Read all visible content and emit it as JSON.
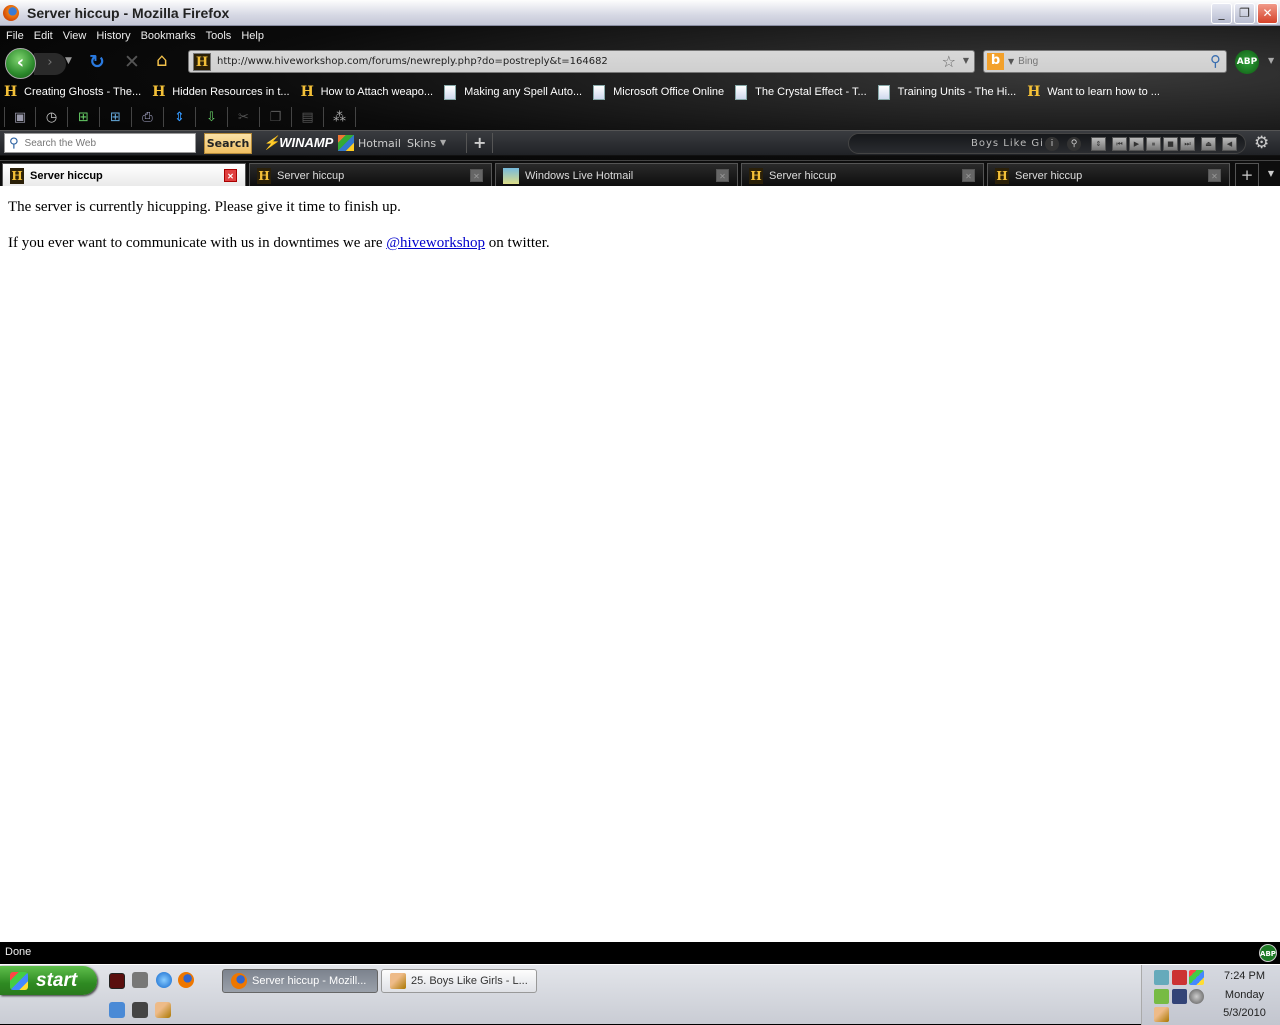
{
  "window": {
    "title": "Server hiccup - Mozilla Firefox",
    "controls": {
      "minimize": "_",
      "restore": "❐",
      "close": "✕"
    }
  },
  "menu": [
    "File",
    "Edit",
    "View",
    "History",
    "Bookmarks",
    "Tools",
    "Help"
  ],
  "nav": {
    "back_icon": "‹",
    "forward_icon": "›",
    "url": "http://www.hiveworkshop.com/forums/newreply.php?do=postreply&t=164682",
    "search_placeholder": "Bing",
    "addon_badge": "ABP"
  },
  "bookmarks": [
    {
      "label": "Creating Ghosts - The...",
      "icon": "hive-icon"
    },
    {
      "label": "Hidden Resources in t...",
      "icon": "hive-icon"
    },
    {
      "label": "How to Attach weapo...",
      "icon": "hive-icon"
    },
    {
      "label": "Making any Spell Auto...",
      "icon": "page-icon"
    },
    {
      "label": "Microsoft Office Online",
      "icon": "page-icon"
    },
    {
      "label": "The Crystal Effect - T...",
      "icon": "page-icon"
    },
    {
      "label": "Training Units - The Hi...",
      "icon": "page-icon"
    },
    {
      "label": "Want to learn how to ...",
      "icon": "hive-icon"
    }
  ],
  "toolbar_icons": [
    "bookmarks-icon",
    "history-icon",
    "new-tab-icon",
    "new-window-icon",
    "print-icon",
    "fullscreen-icon",
    "download-icon",
    "cut-icon",
    "copy-icon",
    "paste-icon",
    "loading-icon"
  ],
  "winamp_toolbar": {
    "search_placeholder": "Search the Web",
    "search_button": "Search",
    "logo_prefix": "⚡",
    "logo": "WINAMP",
    "hotmail": "Hotmail",
    "skins": "Skins",
    "now_playing": "Boys Like Gi"
  },
  "tabs": [
    {
      "label": "Server hiccup",
      "active": true
    },
    {
      "label": "Server hiccup",
      "active": false
    },
    {
      "label": "Windows Live Hotmail",
      "active": false
    },
    {
      "label": "Server hiccup",
      "active": false
    },
    {
      "label": "Server hiccup",
      "active": false
    }
  ],
  "page": {
    "line1": "The server is currently hicupping. Please give it time to finish up.",
    "line2_before": "If you ever want to communicate with us in downtimes we are ",
    "line2_link": "@hiveworkshop",
    "line2_after": " on twitter."
  },
  "status": {
    "text": "Done",
    "abp": "ABP"
  },
  "taskbar": {
    "start_label": "start",
    "buttons": [
      {
        "label": "Server hiccup - Mozill...",
        "active": true
      },
      {
        "label": "25. Boys Like Girls - L...",
        "active": false
      }
    ],
    "clock": {
      "time": "7:24 PM",
      "day": "Monday",
      "date": "5/3/2010"
    }
  }
}
